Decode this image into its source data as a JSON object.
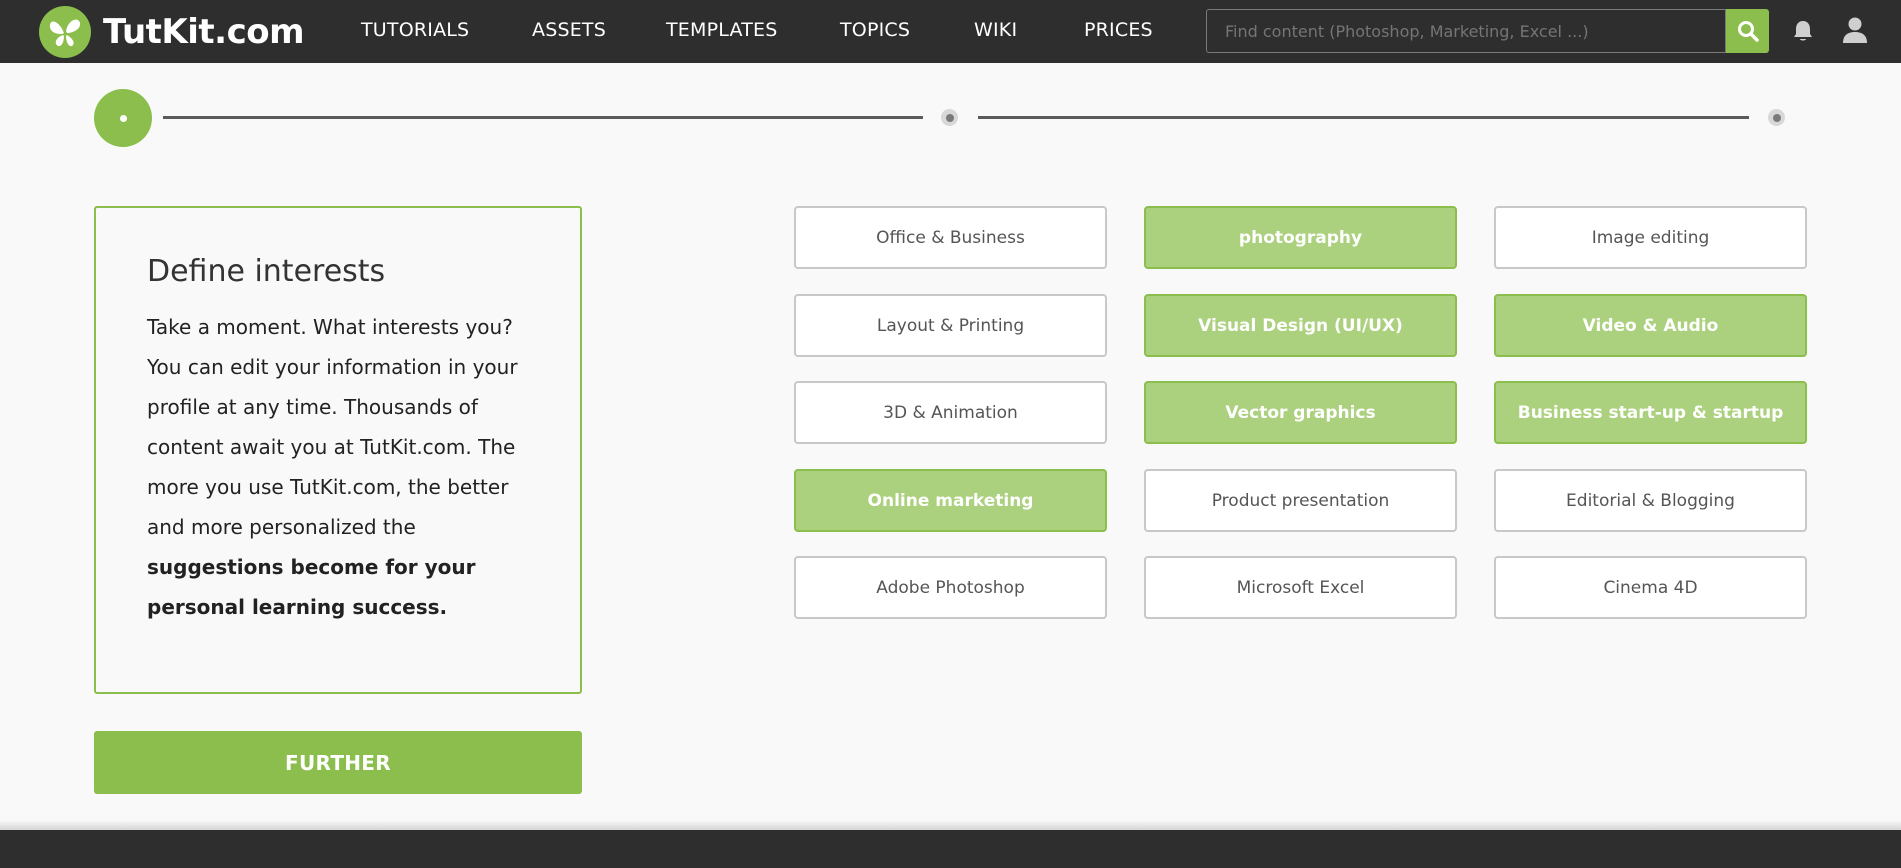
{
  "header": {
    "logo_text": "TutKit.com",
    "nav": [
      {
        "label": "TUTORIALS"
      },
      {
        "label": "ASSETS"
      },
      {
        "label": "TEMPLATES"
      },
      {
        "label": "TOPICS"
      },
      {
        "label": "WIKI"
      },
      {
        "label": "PRICES"
      }
    ],
    "search": {
      "placeholder": "Find content (Photoshop, Marketing, Excel ...)",
      "value": ""
    },
    "icons": {
      "logo": "butterfly-logo-icon",
      "search": "search-icon",
      "notifications": "bell-icon",
      "profile": "user-icon"
    }
  },
  "stepper": {
    "steps": 3,
    "current": 1
  },
  "intro": {
    "title": "Define interests",
    "text": "Take a moment. What interests you? You can edit your information in your profile at any time. Thousands of content await you at TutKit.com. The more you use TutKit.com, the better and more personalized the ",
    "text_bold": "suggestions become for your personal learning success."
  },
  "further_label": "FURTHER",
  "interests": [
    {
      "label": "Office & Business",
      "selected": false
    },
    {
      "label": "photography",
      "selected": true
    },
    {
      "label": "Image editing",
      "selected": false
    },
    {
      "label": "Layout & Printing",
      "selected": false
    },
    {
      "label": "Visual Design (UI/UX)",
      "selected": true
    },
    {
      "label": "Video & Audio",
      "selected": true
    },
    {
      "label": "3D & Animation",
      "selected": false
    },
    {
      "label": "Vector graphics",
      "selected": true
    },
    {
      "label": "Business start-up & startup",
      "selected": true
    },
    {
      "label": "Online marketing",
      "selected": true
    },
    {
      "label": "Product presentation",
      "selected": false
    },
    {
      "label": "Editorial & Blogging",
      "selected": false
    },
    {
      "label": "Adobe Photoshop",
      "selected": false
    },
    {
      "label": "Microsoft Excel",
      "selected": false
    },
    {
      "label": "Cinema 4D",
      "selected": false
    }
  ],
  "colors": {
    "brand_green": "#8bbe4c",
    "selected_fill": "#acd17e",
    "header_bg": "#2e2e2f",
    "page_bg": "#f9f9f9"
  }
}
